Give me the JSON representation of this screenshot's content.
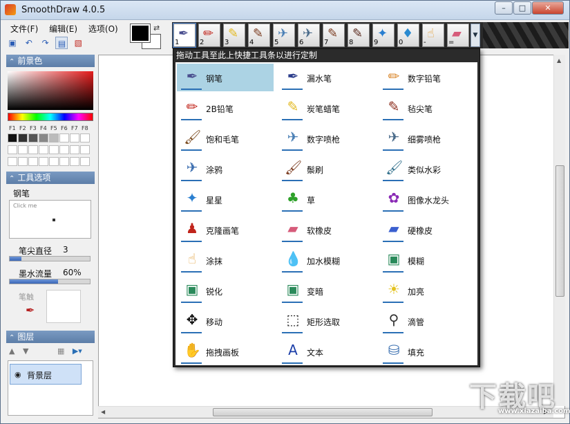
{
  "window": {
    "title": "SmoothDraw 4.0.5",
    "minimize": "–",
    "maximize": "□",
    "close": "✕"
  },
  "menu": [
    "文件(F)",
    "编辑(E)",
    "选项(O)"
  ],
  "quickbar_icons": [
    "save-icon",
    "undo-icon",
    "redo-icon",
    "new-icon",
    "image-icon"
  ],
  "colors": {
    "foreground": "#000000",
    "background": "#ffffff",
    "accent": "#5d7ea8",
    "selection": "#acd3e4"
  },
  "toolstrip": {
    "slots": [
      {
        "num": "1",
        "icon": "pen-icon"
      },
      {
        "num": "2",
        "icon": "pencil-icon"
      },
      {
        "num": "3",
        "icon": "crayon-icon"
      },
      {
        "num": "4",
        "icon": "brush-icon"
      },
      {
        "num": "5",
        "icon": "airbrush-icon"
      },
      {
        "num": "6",
        "icon": "airbrush-icon"
      },
      {
        "num": "7",
        "icon": "brush-icon"
      },
      {
        "num": "8",
        "icon": "brush-icon"
      },
      {
        "num": "9",
        "icon": "star-icon"
      },
      {
        "num": "0",
        "icon": "water-drop-icon"
      },
      {
        "num": "-",
        "icon": "smudge-hand-icon"
      },
      {
        "num": "=",
        "icon": "eraser-icon"
      }
    ]
  },
  "panels": {
    "foreground_title": "前景色",
    "fkeys": [
      "F1",
      "F2",
      "F3",
      "F4",
      "F5",
      "F6",
      "F7",
      "F8"
    ],
    "palette": [
      "#111111",
      "#333333",
      "#555555",
      "#888888",
      "#bbbbbb",
      "#ffffff",
      "#ffffff",
      "#ffffff",
      "#ffffff",
      "#ffffff",
      "#ffffff",
      "#ffffff",
      "#ffffff",
      "#ffffff",
      "#ffffff",
      "#ffffff",
      "#ffffff",
      "#ffffff",
      "#ffffff",
      "#ffffff",
      "#ffffff",
      "#ffffff",
      "#ffffff",
      "#ffffff"
    ],
    "tool_options_title": "工具选项",
    "tool_name": "钢笔",
    "preview_hint": "Click me",
    "tip_size_label": "笔尖直径",
    "tip_size_value": "3",
    "tip_size_fraction": 0.15,
    "ink_flow_label": "墨水流量",
    "ink_flow_value": "60%",
    "ink_flow_fraction": 0.6,
    "brush_label": "笔触",
    "layers_title": "图层",
    "layer_name": "背景层"
  },
  "popup": {
    "header": "拖动工具至此上快捷工具条以进行定制",
    "items": [
      {
        "label": "钢笔",
        "icon": "pen-icon",
        "color": "#4a4f8f",
        "glyph": "✒"
      },
      {
        "label": "漏水笔",
        "icon": "leaky-pen-icon",
        "color": "#2c3e8c",
        "glyph": "✒"
      },
      {
        "label": "数字铅笔",
        "icon": "pencil-icon",
        "color": "#d9862a",
        "glyph": "✏"
      },
      {
        "label": "2B铅笔",
        "icon": "pencil-icon",
        "color": "#c0241b",
        "glyph": "✏"
      },
      {
        "label": "炭笔蜡笔",
        "icon": "crayon-icon",
        "color": "#e2b81f",
        "glyph": "✎"
      },
      {
        "label": "毡尖笔",
        "icon": "marker-icon",
        "color": "#8a2a1a",
        "glyph": "✎"
      },
      {
        "label": "饱和毛笔",
        "icon": "brush-icon",
        "color": "#7a4a1e",
        "glyph": "🖌"
      },
      {
        "label": "数字喷枪",
        "icon": "airbrush-icon",
        "color": "#4a7fb5",
        "glyph": "✈"
      },
      {
        "label": "细雾喷枪",
        "icon": "airbrush-icon",
        "color": "#4a6b8a",
        "glyph": "✈"
      },
      {
        "label": "涂鸦",
        "icon": "spray-icon",
        "color": "#3d6fb0",
        "glyph": "✈"
      },
      {
        "label": "鬃刷",
        "icon": "bristle-brush-icon",
        "color": "#7a3a1e",
        "glyph": "🖌"
      },
      {
        "label": "类似水彩",
        "icon": "watercolor-icon",
        "color": "#2f6e8a",
        "glyph": "🖌"
      },
      {
        "label": "星星",
        "icon": "star-icon",
        "color": "#2a7fd0",
        "glyph": "✦"
      },
      {
        "label": "草",
        "icon": "grass-icon",
        "color": "#2ea12a",
        "glyph": "♣"
      },
      {
        "label": "图像水龙头",
        "icon": "image-hose-icon",
        "color": "#8a2ab5",
        "glyph": "✿"
      },
      {
        "label": "克隆画笔",
        "icon": "clone-stamp-icon",
        "color": "#c0241b",
        "glyph": "♟"
      },
      {
        "label": "软橡皮",
        "icon": "soft-eraser-icon",
        "color": "#d65b7a",
        "glyph": "▰"
      },
      {
        "label": "硬橡皮",
        "icon": "hard-eraser-icon",
        "color": "#3a5fcf",
        "glyph": "▰"
      },
      {
        "label": "涂抹",
        "icon": "smudge-hand-icon",
        "color": "#e3a23f",
        "glyph": "☝"
      },
      {
        "label": "加水模糊",
        "icon": "water-drop-icon",
        "color": "#2a8ad0",
        "glyph": "💧"
      },
      {
        "label": "模糊",
        "icon": "blur-icon",
        "color": "#2a8a5a",
        "glyph": "▣"
      },
      {
        "label": "锐化",
        "icon": "sharpen-icon",
        "color": "#2a8a5a",
        "glyph": "▣"
      },
      {
        "label": "变暗",
        "icon": "darken-icon",
        "color": "#2a8a5a",
        "glyph": "▣"
      },
      {
        "label": "加亮",
        "icon": "lighten-icon",
        "color": "#e3c21f",
        "glyph": "☀"
      },
      {
        "label": "移动",
        "icon": "move-icon",
        "color": "#111111",
        "glyph": "✥"
      },
      {
        "label": "矩形选取",
        "icon": "rect-select-icon",
        "color": "#111111",
        "glyph": "⬚"
      },
      {
        "label": "滴管",
        "icon": "eyedropper-icon",
        "color": "#333333",
        "glyph": "⚲"
      },
      {
        "label": "拖拽画板",
        "icon": "hand-icon",
        "color": "#111111",
        "glyph": "✋"
      },
      {
        "label": "文本",
        "icon": "text-icon",
        "color": "#1b3ea8",
        "glyph": "A"
      },
      {
        "label": "填充",
        "icon": "fill-bucket-icon",
        "color": "#3a6fb0",
        "glyph": "⛁"
      }
    ]
  },
  "watermark": {
    "text": "下载吧",
    "sub": "www.xiazaiba.com"
  }
}
